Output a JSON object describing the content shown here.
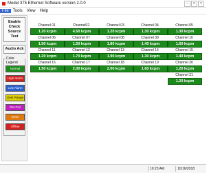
{
  "window": {
    "title": "Model 375 Ethernet Software  version 2.0.0"
  },
  "menu": [
    {
      "label": "File"
    },
    {
      "label": "Tools"
    },
    {
      "label": "View"
    },
    {
      "label": "Help"
    }
  ],
  "left_panel": {
    "enable_button": "Enable Check Source Test",
    "audio_button": "Audio Ack",
    "legend_title": "Color Legend",
    "legend": [
      {
        "label": "Normal",
        "color": "#1e8a1e"
      },
      {
        "label": "High Alarm",
        "color": "#d42020"
      },
      {
        "label": "Low Alarm",
        "color": "#2a5fd0"
      },
      {
        "label": "Over Range",
        "color": "#e0d000"
      },
      {
        "label": "Det Fail",
        "color": "#c020c0"
      },
      {
        "label": "Error",
        "color": "#e07a10"
      },
      {
        "label": "Offline",
        "color": "#d42020"
      }
    ]
  },
  "channels": [
    {
      "label": "Channel 01",
      "value": "1.20 kcpm"
    },
    {
      "label": "Channel02",
      "value": "4.50 kcpm"
    },
    {
      "label": "Channel 03",
      "value": "1.20 kcpm"
    },
    {
      "label": "Channel 04",
      "value": "1.30 kcpm"
    },
    {
      "label": "Channel 05",
      "value": "1.30 kcpm"
    },
    {
      "label": "Channel 06",
      "value": "1.50 kcpm"
    },
    {
      "label": "Channel 07",
      "value": "1.50 kcpm"
    },
    {
      "label": "Channel 08",
      "value": "1.80 kcpm"
    },
    {
      "label": "Channel 09",
      "value": "1.40 kcpm"
    },
    {
      "label": "Channel 10",
      "value": "1.60 kcpm"
    },
    {
      "label": "Channel 11",
      "value": "1.20 kcpm"
    },
    {
      "label": "Channel 12",
      "value": "1.70 kcpm"
    },
    {
      "label": "Channel 13",
      "value": "1.90 kcpm"
    },
    {
      "label": "Channel 14",
      "value": "1.30 kcpm"
    },
    {
      "label": "Channel 15",
      "value": "1.40 kcpm"
    },
    {
      "label": "Channel 16",
      "value": "1.50 kcpm"
    },
    {
      "label": "Channel 17",
      "value": "2.00 kcpm"
    },
    {
      "label": "Channel 18",
      "value": "2.00 kcpm"
    },
    {
      "label": "Channel 19",
      "value": "1.60 kcpm"
    },
    {
      "label": "Channel 20",
      "value": "1.20 kcpm"
    },
    {
      "label": "Channel 21",
      "value": "1.20 kcpm"
    }
  ],
  "status": {
    "time": "10:23 AM",
    "date": "10/16/2018"
  }
}
